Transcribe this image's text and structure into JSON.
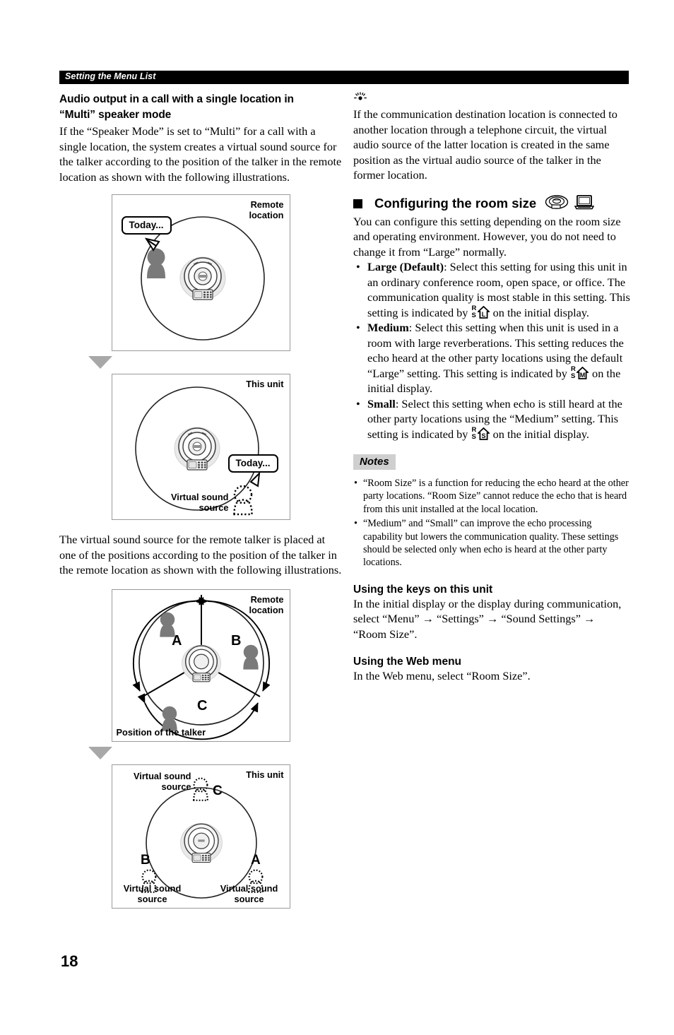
{
  "header": {
    "running_title": "Setting the Menu List"
  },
  "page_number": "18",
  "left_column": {
    "section_heading_line1": "Audio output in a call with a single location in",
    "section_heading_line2": "“Multi” speaker mode",
    "intro_paragraph": "If the “Speaker Mode” is set to “Multi” for a call with a single location, the system creates a virtual sound source for the talker according to the position of the talker in the remote location as shown with the following illustrations.",
    "middle_paragraph": "The virtual sound source for the remote talker is placed at one of the positions according to the position of the talker in the remote location as shown with the following illustrations.",
    "figure1": {
      "corner_label": "Remote\nlocation",
      "balloon_text": "Today...",
      "device_name": "conference-unit-icon",
      "talker_name": "talker-figure"
    },
    "figure2": {
      "corner_label": "This unit",
      "balloon_text": "Today...",
      "virtual_source_label": "Virtual sound\nsource"
    },
    "figure3": {
      "corner_label": "Remote\nlocation",
      "bottom_label": "Position of the talker",
      "sectors": [
        "A",
        "B",
        "C"
      ]
    },
    "figure4": {
      "corner_label": "This unit",
      "sources": [
        {
          "letter": "C",
          "label": "Virtual sound\nsource"
        },
        {
          "letter": "B",
          "label": "Virtual sound\nsource"
        },
        {
          "letter": "A",
          "label": "Virtual sound\nsource"
        }
      ]
    }
  },
  "right_column": {
    "tip_icon": "tip-sun-icon",
    "tip_paragraph": "If the communication destination location is connected to another location through a telephone circuit, the virtual audio source of the latter location is created in the same position as the virtual audio source of the talker in the former location.",
    "room_size_heading": "Configuring the room size",
    "room_size_icons": [
      "conference-unit-top-icon",
      "laptop-icon"
    ],
    "room_size_intro": "You can configure this setting depending on the room size and operating environment. However, you do not need to change it from “Large” normally.",
    "settings": [
      {
        "name": "Large (Default)",
        "text_before_icon": ": Select this setting for using this unit in an ordinary conference room, open space, or office. The communication quality is most stable in this setting. This setting is indicated by ",
        "icon_letter": "L",
        "icon_name": "room-size-large-icon",
        "text_after_icon": " on the initial display."
      },
      {
        "name": "Medium",
        "text_before_icon": ": Select this setting when this unit is used in a room with large reverberations. This setting reduces the echo heard at the other party locations using the default “Large” setting. This setting is indicated by ",
        "icon_letter": "M",
        "icon_name": "room-size-medium-icon",
        "text_after_icon": " on the initial display."
      },
      {
        "name": "Small",
        "text_before_icon": ": Select this setting when echo is still heard at the other party locations using the “Medium” setting. This setting is indicated by ",
        "icon_letter": "S",
        "icon_name": "room-size-small-icon",
        "text_after_icon": " on the initial display."
      }
    ],
    "notes_title": "Notes",
    "notes": [
      "“Room Size” is a function for reducing the echo heard at the other party locations. “Room Size” cannot reduce the echo that is heard from this unit installed at the local location.",
      "“Medium” and “Small” can improve the echo processing capability but lowers the communication quality. These settings should be selected only when echo is heard at the other party locations."
    ],
    "keys_heading": "Using the keys on this unit",
    "keys_text": "In the initial display or the display during communication, select “Menu” → “Settings” → “Sound Settings” → “Room Size”.",
    "web_heading": "Using the Web menu",
    "web_text": "In the Web menu, select “Room Size”."
  },
  "colors": {
    "header_bar": "#000000",
    "header_text": "#ffffff",
    "person_fill": "#7a7a7a",
    "triangle": "#a8a8a8",
    "notes_badge_bg": "#cfcfcf",
    "figure_border": "#9a9a9a"
  }
}
